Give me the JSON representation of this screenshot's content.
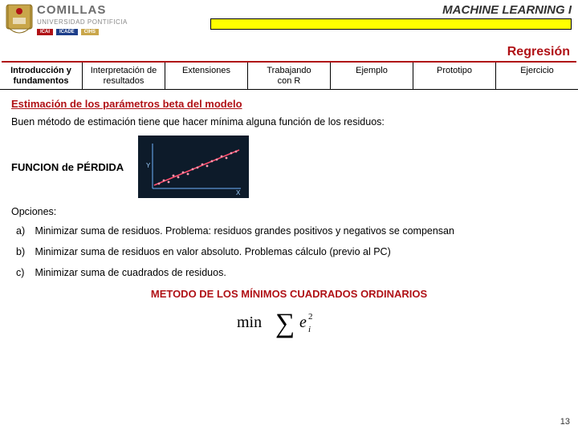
{
  "header": {
    "university": "COMILLAS",
    "subline": "UNIVERSIDAD PONTIFICIA",
    "bars": [
      "ICAI",
      "ICADE",
      "CIHS"
    ],
    "course": "MACHINE LEARNING I",
    "topic": "Regresión"
  },
  "tabs": [
    {
      "line1": "Introducción y",
      "line2": "fundamentos",
      "active": true
    },
    {
      "line1": "Interpretación de",
      "line2": "resultados",
      "active": false
    },
    {
      "line1": "Extensiones",
      "line2": "",
      "active": false
    },
    {
      "line1": "Trabajando",
      "line2": "con R",
      "active": false
    },
    {
      "line1": "Ejemplo",
      "line2": "",
      "active": false
    },
    {
      "line1": "Prototipo",
      "line2": "",
      "active": false
    },
    {
      "line1": "Ejercicio",
      "line2": "",
      "active": false
    }
  ],
  "body": {
    "section_title": "Estimación de los parámetros beta del modelo",
    "intro": "Buen método de estimación tiene que hacer mínima alguna función de los residuos:",
    "loss_label": "FUNCION de PÉRDIDA",
    "options_label": "Opciones:",
    "options": [
      {
        "letter": "a)",
        "text": "Minimizar suma de residuos. Problema: residuos grandes positivos y negativos se compensan"
      },
      {
        "letter": "b)",
        "text": "Minimizar suma de residuos en valor absoluto. Problemas cálculo (previo al PC)"
      },
      {
        "letter": "c)",
        "text": "Minimizar suma de cuadrados de residuos."
      }
    ],
    "method": "METODO DE LOS MÍNIMOS CUADRADOS ORDINARIOS",
    "formula_text": "min Σ eᵢ²"
  },
  "page_number": "13"
}
